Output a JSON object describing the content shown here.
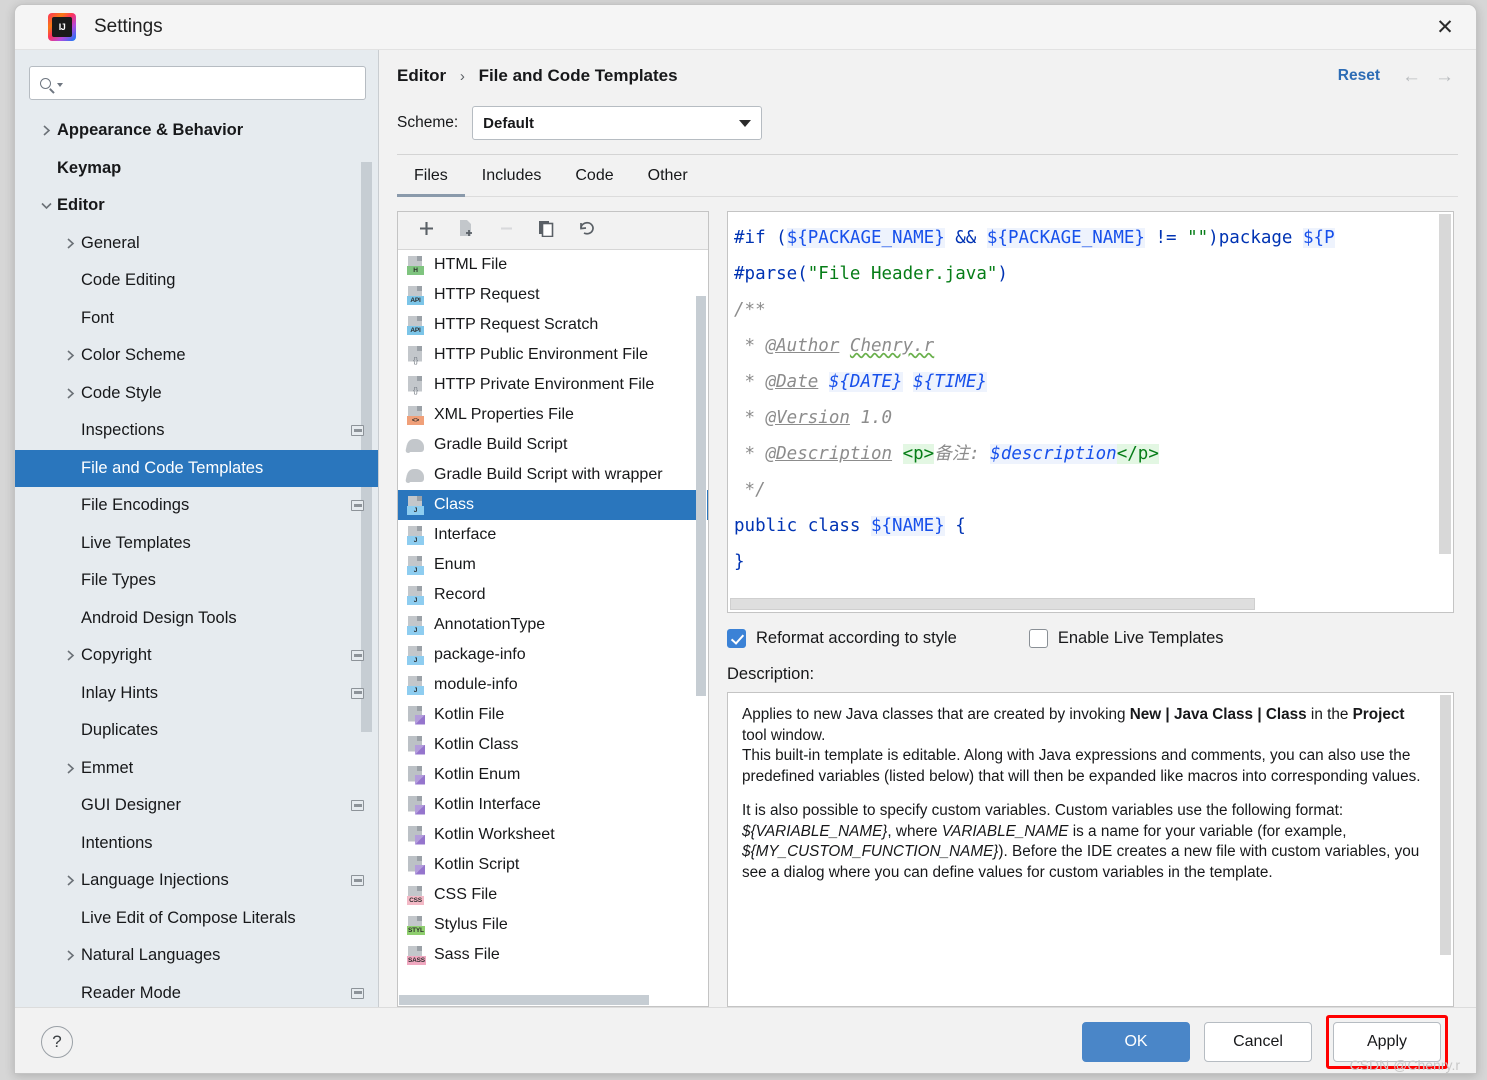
{
  "window": {
    "title": "Settings",
    "logo_text": "IJ",
    "close_icon": "close-icon"
  },
  "search": {
    "value": "",
    "placeholder": ""
  },
  "sidebar": {
    "items": [
      {
        "label": "Appearance & Behavior",
        "level": 0,
        "bold": true,
        "chevron": "right",
        "selected": false,
        "badge": false
      },
      {
        "label": "Keymap",
        "level": 0,
        "bold": true,
        "chevron": "none",
        "selected": false,
        "badge": false
      },
      {
        "label": "Editor",
        "level": 0,
        "bold": true,
        "chevron": "down",
        "selected": false,
        "badge": false
      },
      {
        "label": "General",
        "level": 1,
        "bold": false,
        "chevron": "right",
        "selected": false,
        "badge": false
      },
      {
        "label": "Code Editing",
        "level": 1,
        "bold": false,
        "chevron": "none",
        "selected": false,
        "badge": false
      },
      {
        "label": "Font",
        "level": 1,
        "bold": false,
        "chevron": "none",
        "selected": false,
        "badge": false
      },
      {
        "label": "Color Scheme",
        "level": 1,
        "bold": false,
        "chevron": "right",
        "selected": false,
        "badge": false
      },
      {
        "label": "Code Style",
        "level": 1,
        "bold": false,
        "chevron": "right",
        "selected": false,
        "badge": false
      },
      {
        "label": "Inspections",
        "level": 1,
        "bold": false,
        "chevron": "none",
        "selected": false,
        "badge": true
      },
      {
        "label": "File and Code Templates",
        "level": 1,
        "bold": false,
        "chevron": "none",
        "selected": true,
        "badge": false
      },
      {
        "label": "File Encodings",
        "level": 1,
        "bold": false,
        "chevron": "none",
        "selected": false,
        "badge": true
      },
      {
        "label": "Live Templates",
        "level": 1,
        "bold": false,
        "chevron": "none",
        "selected": false,
        "badge": false
      },
      {
        "label": "File Types",
        "level": 1,
        "bold": false,
        "chevron": "none",
        "selected": false,
        "badge": false
      },
      {
        "label": "Android Design Tools",
        "level": 1,
        "bold": false,
        "chevron": "none",
        "selected": false,
        "badge": false
      },
      {
        "label": "Copyright",
        "level": 1,
        "bold": false,
        "chevron": "right",
        "selected": false,
        "badge": true
      },
      {
        "label": "Inlay Hints",
        "level": 1,
        "bold": false,
        "chevron": "none",
        "selected": false,
        "badge": true
      },
      {
        "label": "Duplicates",
        "level": 1,
        "bold": false,
        "chevron": "none",
        "selected": false,
        "badge": false
      },
      {
        "label": "Emmet",
        "level": 1,
        "bold": false,
        "chevron": "right",
        "selected": false,
        "badge": false
      },
      {
        "label": "GUI Designer",
        "level": 1,
        "bold": false,
        "chevron": "none",
        "selected": false,
        "badge": true
      },
      {
        "label": "Intentions",
        "level": 1,
        "bold": false,
        "chevron": "none",
        "selected": false,
        "badge": false
      },
      {
        "label": "Language Injections",
        "level": 1,
        "bold": false,
        "chevron": "right",
        "selected": false,
        "badge": true
      },
      {
        "label": "Live Edit of Compose Literals",
        "level": 1,
        "bold": false,
        "chevron": "none",
        "selected": false,
        "badge": false
      },
      {
        "label": "Natural Languages",
        "level": 1,
        "bold": false,
        "chevron": "right",
        "selected": false,
        "badge": false
      },
      {
        "label": "Reader Mode",
        "level": 1,
        "bold": false,
        "chevron": "none",
        "selected": false,
        "badge": true
      }
    ]
  },
  "header": {
    "breadcrumb_root": "Editor",
    "breadcrumb_separator": "›",
    "breadcrumb_current": "File and Code Templates",
    "reset_label": "Reset",
    "back_icon": "arrow-left-icon",
    "forward_icon": "arrow-right-icon",
    "scheme_label": "Scheme:",
    "scheme_value": "Default"
  },
  "tabs": [
    {
      "label": "Files",
      "active": true
    },
    {
      "label": "Includes",
      "active": false
    },
    {
      "label": "Code",
      "active": false
    },
    {
      "label": "Other",
      "active": false
    }
  ],
  "filelist": {
    "toolbar": [
      {
        "name": "add-template-button",
        "icon": "plus-icon",
        "disabled": false
      },
      {
        "name": "create-child-template-button",
        "icon": "new-file-icon",
        "disabled": false
      },
      {
        "name": "remove-template-button",
        "icon": "minus-icon",
        "disabled": true
      },
      {
        "name": "copy-template-button",
        "icon": "copy-icon",
        "disabled": false
      },
      {
        "name": "reset-template-button",
        "icon": "undo-icon",
        "disabled": false
      }
    ],
    "items": [
      {
        "label": "HTML File",
        "icon": "html-file-icon",
        "kind": "tag",
        "tag": "H",
        "tagcolor": "#7fc47f",
        "selected": false
      },
      {
        "label": "HTTP Request",
        "icon": "http-request-icon",
        "kind": "tag",
        "tag": "API",
        "tagcolor": "#7cc5e8",
        "selected": false
      },
      {
        "label": "HTTP Request Scratch",
        "icon": "http-request-scratch-icon",
        "kind": "tag",
        "tag": "API",
        "tagcolor": "#7cc5e8",
        "selected": false
      },
      {
        "label": "HTTP Public Environment File",
        "icon": "http-env-file-icon",
        "kind": "braces",
        "tag": "{}",
        "tagcolor": "transparent",
        "selected": false
      },
      {
        "label": "HTTP Private Environment File",
        "icon": "http-private-env-file-icon",
        "kind": "braces",
        "tag": "{}",
        "tagcolor": "transparent",
        "selected": false
      },
      {
        "label": "XML Properties File",
        "icon": "xml-properties-file-icon",
        "kind": "tag",
        "tag": "<>",
        "tagcolor": "#f0a079",
        "selected": false
      },
      {
        "label": "Gradle Build Script",
        "icon": "gradle-icon",
        "kind": "elephant",
        "tag": "",
        "tagcolor": "",
        "selected": false
      },
      {
        "label": "Gradle Build Script with wrapper",
        "icon": "gradle-wrapper-icon",
        "kind": "elephant",
        "tag": "",
        "tagcolor": "",
        "selected": false
      },
      {
        "label": "Class",
        "icon": "java-class-icon",
        "kind": "tag",
        "tag": "J",
        "tagcolor": "#8ecdf0",
        "selected": true
      },
      {
        "label": "Interface",
        "icon": "java-interface-icon",
        "kind": "tag",
        "tag": "J",
        "tagcolor": "#8ecdf0",
        "selected": false
      },
      {
        "label": "Enum",
        "icon": "java-enum-icon",
        "kind": "tag",
        "tag": "J",
        "tagcolor": "#8ecdf0",
        "selected": false
      },
      {
        "label": "Record",
        "icon": "java-record-icon",
        "kind": "tag",
        "tag": "J",
        "tagcolor": "#8ecdf0",
        "selected": false
      },
      {
        "label": "AnnotationType",
        "icon": "java-annotation-icon",
        "kind": "tag",
        "tag": "J",
        "tagcolor": "#8ecdf0",
        "selected": false
      },
      {
        "label": "package-info",
        "icon": "java-package-info-icon",
        "kind": "tag",
        "tag": "J",
        "tagcolor": "#8ecdf0",
        "selected": false
      },
      {
        "label": "module-info",
        "icon": "java-module-info-icon",
        "kind": "tag",
        "tag": "J",
        "tagcolor": "#8ecdf0",
        "selected": false
      },
      {
        "label": "Kotlin File",
        "icon": "kotlin-file-icon",
        "kind": "kotlin",
        "tag": "",
        "tagcolor": "",
        "selected": false
      },
      {
        "label": "Kotlin Class",
        "icon": "kotlin-class-icon",
        "kind": "kotlin",
        "tag": "",
        "tagcolor": "",
        "selected": false
      },
      {
        "label": "Kotlin Enum",
        "icon": "kotlin-enum-icon",
        "kind": "kotlin",
        "tag": "",
        "tagcolor": "",
        "selected": false
      },
      {
        "label": "Kotlin Interface",
        "icon": "kotlin-interface-icon",
        "kind": "kotlin",
        "tag": "",
        "tagcolor": "",
        "selected": false
      },
      {
        "label": "Kotlin Worksheet",
        "icon": "kotlin-worksheet-icon",
        "kind": "kotlin",
        "tag": "",
        "tagcolor": "",
        "selected": false
      },
      {
        "label": "Kotlin Script",
        "icon": "kotlin-script-icon",
        "kind": "kotlin",
        "tag": "",
        "tagcolor": "",
        "selected": false
      },
      {
        "label": "CSS File",
        "icon": "css-file-icon",
        "kind": "tag",
        "tag": "CSS",
        "tagcolor": "#f3b9c6",
        "selected": false
      },
      {
        "label": "Stylus File",
        "icon": "stylus-file-icon",
        "kind": "tag",
        "tag": "STYL",
        "tagcolor": "#8fcf6f",
        "selected": false
      },
      {
        "label": "Sass File",
        "icon": "sass-file-icon",
        "kind": "tag",
        "tag": "SASS",
        "tagcolor": "#f0a8c0",
        "selected": false
      }
    ]
  },
  "editor": {
    "lines": [
      "#if (${PACKAGE_NAME} && ${PACKAGE_NAME} != \"\")package ${P",
      "#parse(\"File Header.java\")",
      "/**",
      " * @Author Chenry.r",
      " * @Date ${DATE} ${TIME}",
      " * @Version 1.0",
      " * @Description <p>备注: $description</p>",
      " */",
      "public class ${NAME} {",
      "}"
    ]
  },
  "options": {
    "reformat_label": "Reformat according to style",
    "reformat_checked": true,
    "live_templates_label": "Enable Live Templates",
    "live_templates_checked": false
  },
  "description": {
    "label": "Description:",
    "p1_a": "Applies to new Java classes that are created by invoking ",
    "p1_b": "New | Java Class | Class",
    "p1_c": " in the ",
    "p1_d": "Project",
    "p1_e": " tool window.",
    "p2": "This built-in template is editable. Along with Java expressions and comments, you can also use the predefined variables (listed below) that will then be expanded like macros into corresponding values.",
    "p3_a": "It is also possible to specify custom variables. Custom variables use the following format: ",
    "p3_b": "${VARIABLE_NAME}",
    "p3_c": ", where ",
    "p3_d": "VARIABLE_NAME",
    "p3_e": " is a name for your variable (for example, ",
    "p3_f": "${MY_CUSTOM_FUNCTION_NAME}",
    "p3_g": "). Before the IDE creates a new file with custom variables, you see a dialog where you can define values for custom variables in the template."
  },
  "footer": {
    "help_label": "?",
    "ok_label": "OK",
    "cancel_label": "Cancel",
    "apply_label": "Apply",
    "watermark": "CSDN @Chenry.r"
  },
  "colors": {
    "selection_blue": "#2a76bd",
    "primary_button": "#4a86c8",
    "link_blue": "#2d6cb5",
    "highlight_red": "#ff0000",
    "sidebar_bg": "#e6ebef"
  }
}
